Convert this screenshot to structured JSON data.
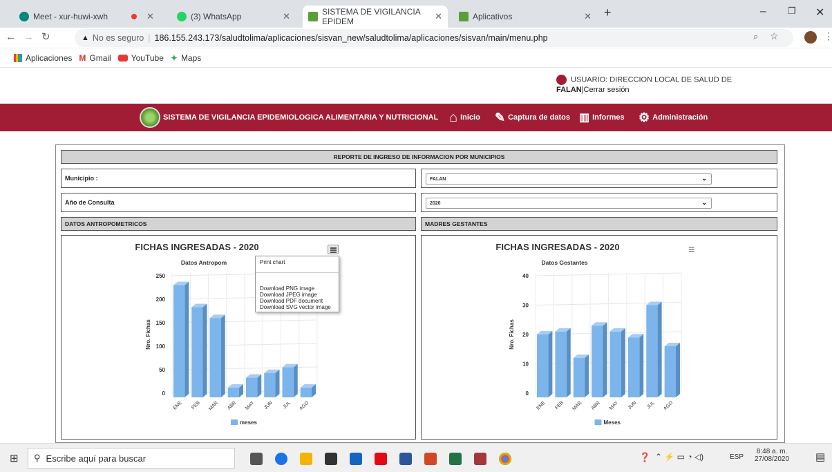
{
  "browser": {
    "tabs": [
      {
        "label": "Meet - xur-huwi-xwh",
        "active": false
      },
      {
        "label": "(3) WhatsApp",
        "active": false
      },
      {
        "label": "SISTEMA DE VIGILANCIA EPIDEM",
        "active": true
      },
      {
        "label": "Aplicativos",
        "active": false
      }
    ],
    "new_tab": "+",
    "security_text": "No es seguro",
    "url": "186.155.243.173/saludtolima/aplicaciones/sisvan_new/saludtolima/aplicaciones/sisvan/main/menu.php",
    "bookmarks": [
      "Aplicaciones",
      "Gmail",
      "YouTube",
      "Maps"
    ]
  },
  "user": {
    "label": "USUARIO: DIRECCION LOCAL DE SALUD DE",
    "line2": "FALAN",
    "logout": "|Cerrar sesión"
  },
  "nav": {
    "title": "SISTEMA DE VIGILANCIA EPIDEMIOLOGICA ALIMENTARIA Y NUTRICIONAL",
    "inicio": "Inicio",
    "captura": "Captura de datos",
    "informes": "Informes",
    "admin": "Administración"
  },
  "report": {
    "title": "REPORTE DE INGRESO DE INFORMACION POR MUNICIPIOS",
    "municipio_label": "Municipio :",
    "municipio_value": "FALAN",
    "anio_label": "Año de Consulta",
    "anio_value": "2020",
    "left_header": "DATOS ANTROPOMETRICOS",
    "right_header": "MADRES GESTANTES"
  },
  "export_menu": {
    "print": "Print chart",
    "png": "Download PNG image",
    "jpeg": "Download JPEG image",
    "pdf": "Download PDF document",
    "svg": "Download SVG vector image"
  },
  "chart_data": [
    {
      "type": "bar",
      "title": "FICHAS INGRESADAS - 2020",
      "subtitle": "Datos Antropom",
      "ylabel": "Nro. Fichas",
      "categories": [
        "ENE",
        "FEB",
        "MAR",
        "ABR",
        "MAY",
        "JUN",
        "JUL",
        "AGO"
      ],
      "series": [
        {
          "name": "meses",
          "values": [
            230,
            183,
            160,
            12,
            33,
            43,
            55,
            12
          ]
        }
      ],
      "ylim": [
        0,
        250
      ],
      "yticks": [
        0,
        50,
        100,
        150,
        200,
        250
      ],
      "color": "#7cb5ec",
      "three_d": true
    },
    {
      "type": "bar",
      "title": "FICHAS INGRESADAS - 2020",
      "subtitle": "Datos Gestantes",
      "ylabel": "Nro. Fichas",
      "categories": [
        "ENE",
        "FEB",
        "MAR",
        "ABR",
        "MAY",
        "JUN",
        "JUL",
        "AGO"
      ],
      "series": [
        {
          "name": "Meses",
          "values": [
            20,
            21,
            12,
            23,
            21,
            19,
            30,
            16
          ]
        }
      ],
      "ylim": [
        0,
        40
      ],
      "yticks": [
        0,
        10,
        20,
        30,
        40
      ],
      "color": "#7cb5ec",
      "three_d": true
    }
  ],
  "taskbar": {
    "search_placeholder": "Escribe aquí para buscar",
    "lang": "ESP",
    "time": "8:48 a. m.",
    "date": "27/08/2020"
  }
}
